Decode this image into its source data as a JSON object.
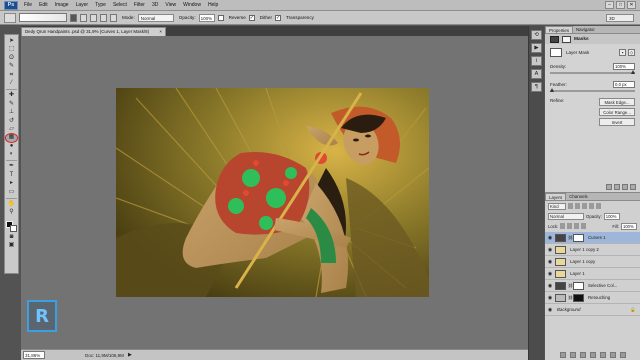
{
  "app": {
    "logo": "Ps"
  },
  "menubar": {
    "items": [
      "File",
      "Edit",
      "Image",
      "Layer",
      "Type",
      "Select",
      "Filter",
      "3D",
      "View",
      "Window",
      "Help"
    ],
    "min": "–",
    "max": "□",
    "close": "✕"
  },
  "options": {
    "mode_label": "Mode:",
    "mode_value": "Normal",
    "opacity_label": "Opacity:",
    "opacity_value": "100%",
    "reverse_label": "Reverse",
    "dither_label": "Dither",
    "transparency_label": "Transparency",
    "workspace": "3D"
  },
  "document": {
    "tab_title": "Dedy Qrun Handpaints .psd @ 31,9% (Curves 1, Layer Mask/8)",
    "tab_close": "×"
  },
  "status": {
    "zoom": "31,86%",
    "doc_size": "Doc: 11,9M/106,9M",
    "arrow": "▶"
  },
  "properties": {
    "tabs": [
      "Properties",
      "Navigator"
    ],
    "title": "Masks",
    "layer_mask_label": "Layer Mask",
    "density_label": "Density:",
    "density_value": "100%",
    "density_level": 1.0,
    "feather_label": "Feather:",
    "feather_value": "0,0 px",
    "feather_level": 0.0,
    "refine_label": "Refine:",
    "refine_buttons": [
      "Mask Edge...",
      "Color Range...",
      "Invert"
    ]
  },
  "layers_panel": {
    "tabs": [
      "Layers",
      "Channels"
    ],
    "kind_label": "Kind",
    "blend_mode": "Normal",
    "opacity_label": "Opacity:",
    "opacity_value": "100%",
    "lock_label": "Lock:",
    "fill_label": "Fill:",
    "fill_value": "100%",
    "layers": [
      {
        "name": "Curves 1",
        "selected": true,
        "thumb": "adj",
        "mask": true
      },
      {
        "name": "Layer 1 copy 2",
        "selected": false,
        "thumb": "copy",
        "mask": false
      },
      {
        "name": "Layer 1 copy",
        "selected": false,
        "thumb": "copy",
        "mask": false
      },
      {
        "name": "Layer 1",
        "selected": false,
        "thumb": "copy",
        "mask": false
      },
      {
        "name": "Selective Col...",
        "selected": false,
        "thumb": "adj",
        "mask": true
      },
      {
        "name": "Retouching",
        "selected": false,
        "thumb": "retouch",
        "mask": true
      },
      {
        "name": "Background",
        "selected": false,
        "thumb": "photo",
        "mask": false,
        "locked": true
      }
    ]
  },
  "watermark": {
    "letter": "R"
  },
  "colors": {
    "accent_selected": "#9db6d9",
    "active_tool_ring": "#d4262a",
    "watermark": "#3aa0e0"
  }
}
